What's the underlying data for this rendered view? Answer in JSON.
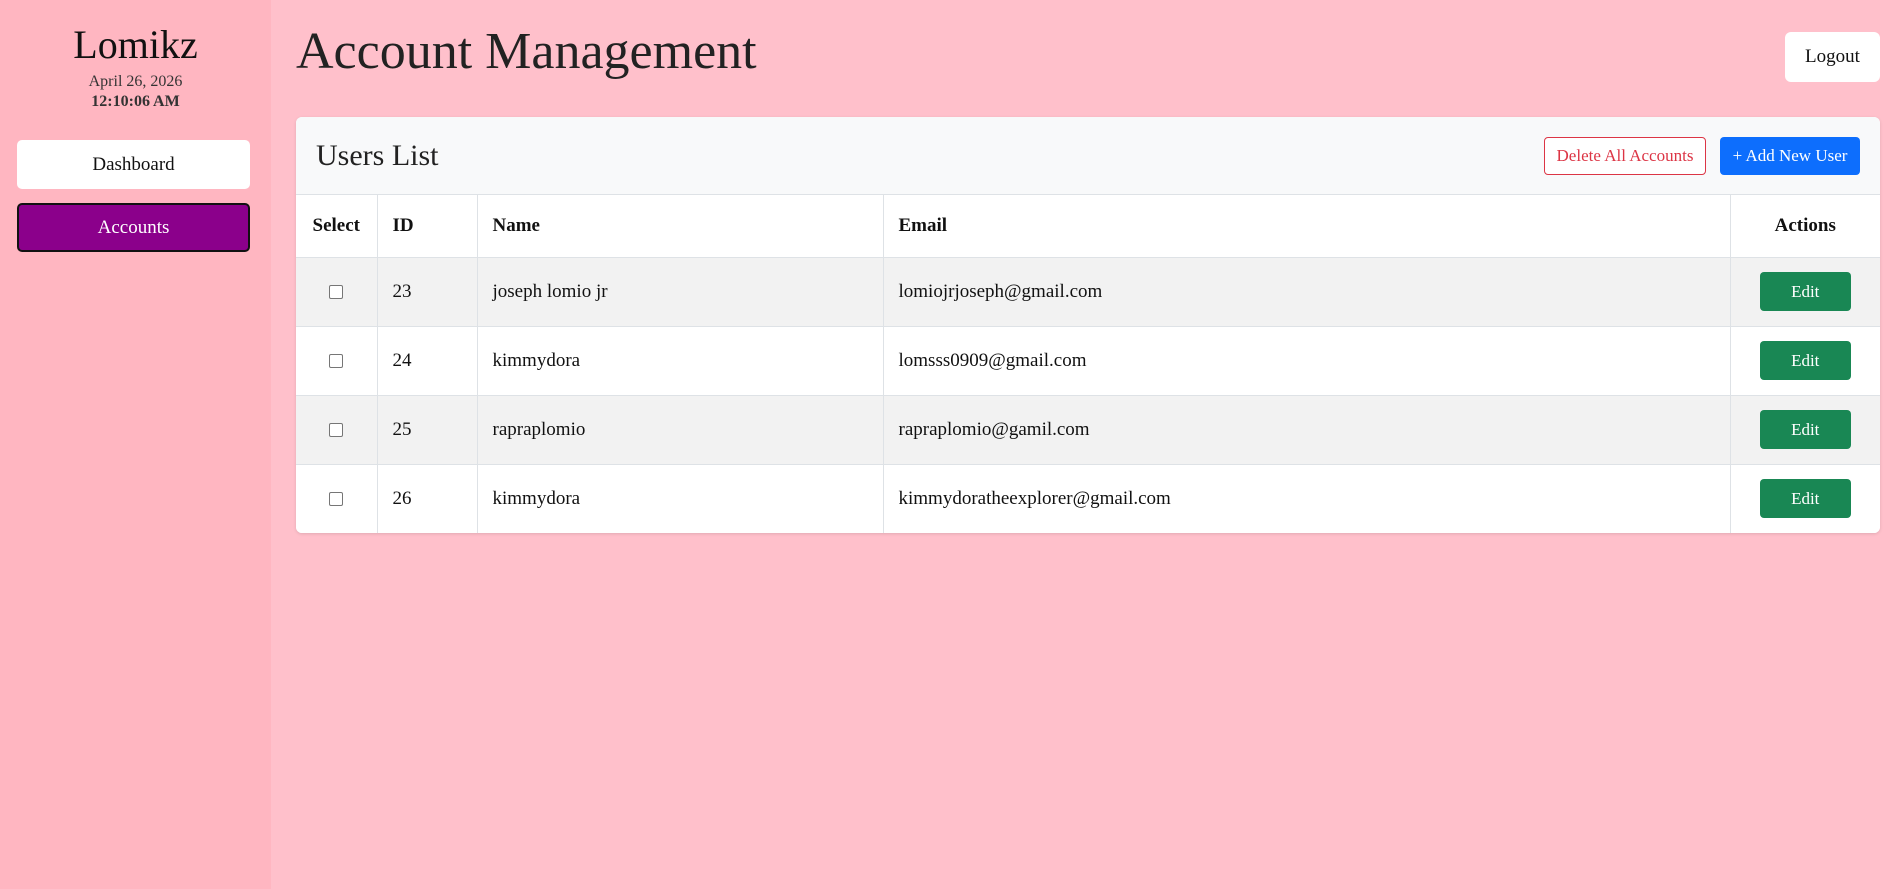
{
  "sidebar": {
    "brand": "Lomikz",
    "date": "April 26, 2026",
    "time": "12:10:06 AM",
    "nav": [
      {
        "label": "Dashboard",
        "active": false
      },
      {
        "label": "Accounts",
        "active": true
      }
    ]
  },
  "header": {
    "title": "Account Management",
    "logout_label": "Logout"
  },
  "users_card": {
    "title": "Users List",
    "delete_all_label": "Delete All Accounts",
    "add_user_label": "+ Add New User",
    "columns": {
      "select": "Select",
      "id": "ID",
      "name": "Name",
      "email": "Email",
      "actions": "Actions"
    },
    "rows": [
      {
        "id": "23",
        "name": "joseph lomio jr",
        "email": "lomiojrjoseph@gmail.com",
        "action": "Edit"
      },
      {
        "id": "24",
        "name": "kimmydora",
        "email": "lomsss0909@gmail.com",
        "action": "Edit"
      },
      {
        "id": "25",
        "name": "rapraplomio",
        "email": "rapraplomio@gamil.com",
        "action": "Edit"
      },
      {
        "id": "26",
        "name": "kimmydora",
        "email": "kimmydoratheexplorer@gmail.com",
        "action": "Edit"
      }
    ]
  },
  "colors": {
    "background": "#ffc0cb",
    "sidebar": "#ffb6c1",
    "active_nav": "#8b008b",
    "primary": "#0d6efd",
    "danger": "#dc3545",
    "success": "#198754"
  }
}
